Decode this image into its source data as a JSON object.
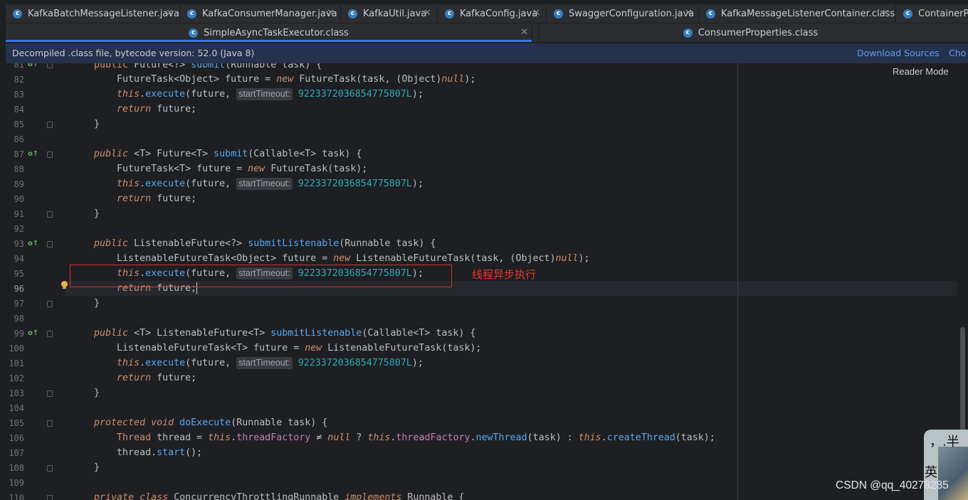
{
  "tabs_row1": [
    {
      "label": "KafkaBatchMessageListener.java",
      "icon": "class-icon",
      "closable": true
    },
    {
      "label": "KafkaConsumerManager.java",
      "icon": "class-icon",
      "closable": true
    },
    {
      "label": "KafkaUtil.java",
      "icon": "class-icon",
      "closable": true
    },
    {
      "label": "KafkaConfig.java",
      "icon": "class-icon",
      "closable": true
    },
    {
      "label": "SwaggerConfiguration.java",
      "icon": "class-icon",
      "closable": true
    },
    {
      "label": "KafkaMessageListenerContainer.class",
      "icon": "class-file-icon",
      "closable": true
    },
    {
      "label": "ContainerPro",
      "icon": "class-file-icon",
      "closable": false
    }
  ],
  "tabs_row2": [
    {
      "label": "SimpleAsyncTaskExecutor.class",
      "icon": "class-file-icon",
      "active": true,
      "closable": true
    },
    {
      "label": "ConsumerProperties.class",
      "icon": "class-file-icon",
      "active": false,
      "closable": false
    }
  ],
  "notification": {
    "message": "Decompiled .class file, bytecode version: 52.0 (Java 8)",
    "download_sources": "Download Sources",
    "choose": "Cho"
  },
  "editor": {
    "reader_mode": "Reader Mode",
    "current_line": 96,
    "hint_label": "startTimeout:",
    "line_numbers": [
      81,
      82,
      83,
      84,
      85,
      86,
      87,
      88,
      89,
      90,
      91,
      92,
      93,
      94,
      95,
      96,
      97,
      98,
      99,
      100,
      101,
      102,
      103,
      104,
      105,
      106,
      107,
      108,
      109,
      110
    ]
  },
  "annotation": {
    "text": "线程异步执行",
    "color": "#e8382e"
  },
  "widget": {
    "text1": "，.半",
    "text2": "英"
  },
  "watermark": "CSDN @qq_40278285",
  "colors": {
    "accent": "#3574f0",
    "keyword": "#cf8e6d",
    "function": "#56a8f5",
    "number": "#2aacb8",
    "field": "#c77dbb"
  }
}
